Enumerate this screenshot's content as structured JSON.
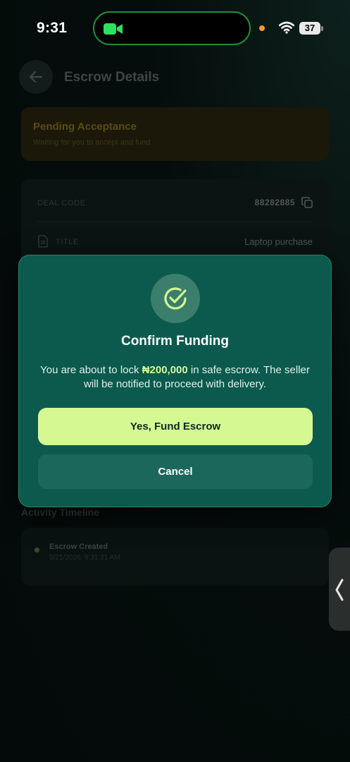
{
  "status_bar": {
    "time": "9:31",
    "battery": "37"
  },
  "header": {
    "title": "Escrow Details"
  },
  "status_card": {
    "title": "Pending Acceptance",
    "subtitle": "Waiting for you to accept and fund"
  },
  "details": {
    "deal_code_label": "DEAL CODE",
    "deal_code_value": "88282885",
    "title_label": "TITLE",
    "title_value": "Laptop purchase"
  },
  "timeline": {
    "heading": "Activity Timeline",
    "items": [
      {
        "title": "Escrow Created",
        "time": "5/21/2026, 9:31:31 AM"
      }
    ]
  },
  "modal": {
    "title": "Confirm Funding",
    "body_prefix": "You are about to lock ",
    "amount": "₦200,000",
    "body_suffix": " in safe escrow. The seller will be notified to proceed with delivery.",
    "confirm_label": "Yes, Fund Escrow",
    "cancel_label": "Cancel"
  },
  "colors": {
    "accent": "#d5f893",
    "modal_bg": "#0b5a4d",
    "status_pending": "#5a4d12"
  }
}
